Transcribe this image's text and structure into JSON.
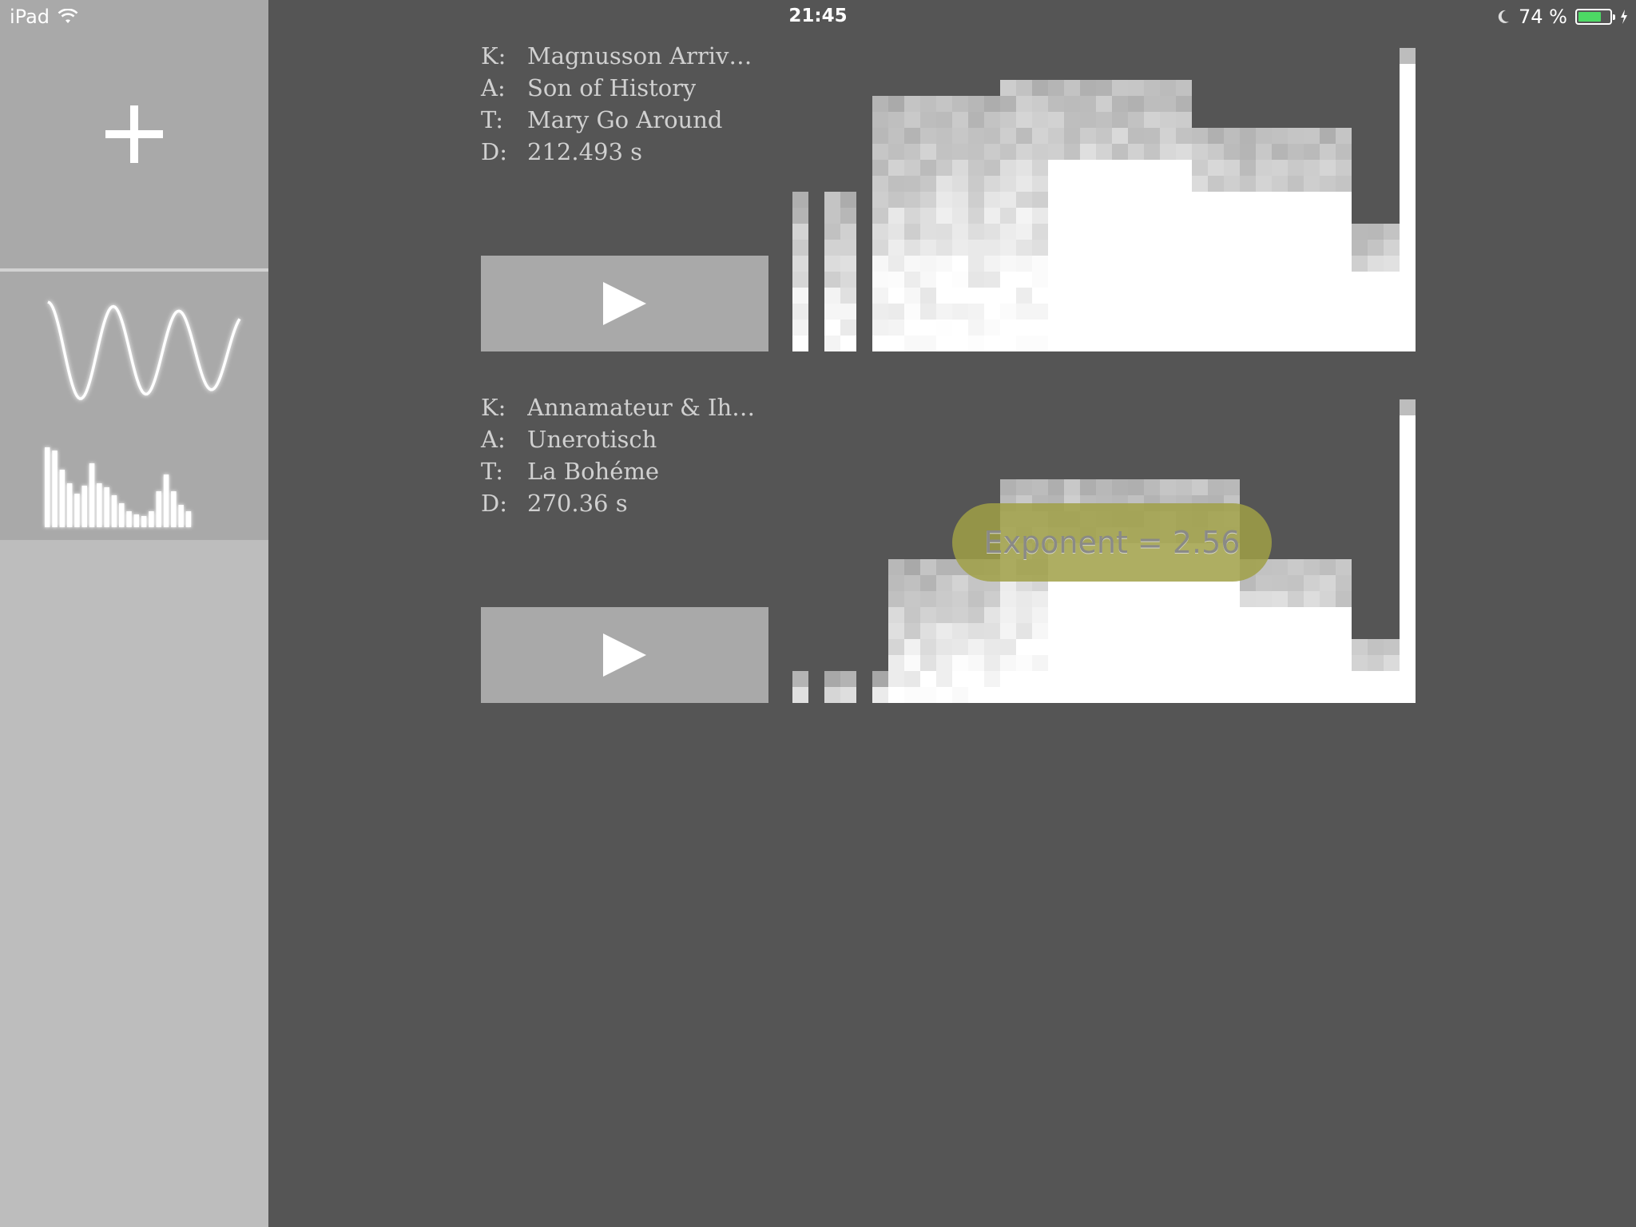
{
  "status_bar": {
    "device": "iPad",
    "time": "21:45",
    "battery_percent": "74 %",
    "battery_level": 0.74,
    "battery_color": "#4cd964"
  },
  "sidebar": {
    "add_icon": "plus-icon",
    "viz_icons": [
      "sine-wave-icon",
      "bar-spectrum-icon"
    ]
  },
  "tracks": [
    {
      "labels": {
        "k": "K:",
        "a": "A:",
        "t": "T:",
        "d": "D:"
      },
      "composer": "Magnusson Arriv…",
      "artist": "Son of History",
      "title": "Mary Go Around",
      "duration": "212.493 s",
      "play_icon": "play-icon",
      "spectrogram_seed": 3
    },
    {
      "labels": {
        "k": "K:",
        "a": "A:",
        "t": "T:",
        "d": "D:"
      },
      "composer": "Annamateur & Ih…",
      "artist": "Unerotisch",
      "title": "La Bohéme",
      "duration": "270.36 s",
      "play_icon": "play-icon",
      "spectrogram_seed": 7
    }
  ],
  "toast": {
    "text": "Exponent = 2.56"
  }
}
